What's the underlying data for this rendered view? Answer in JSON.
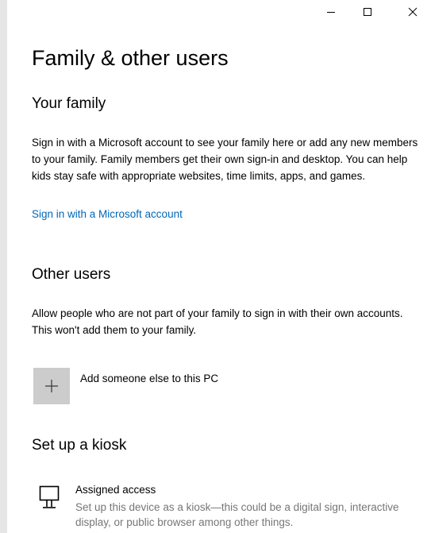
{
  "window": {
    "minimize_icon": "minimize-icon",
    "maximize_icon": "maximize-icon",
    "close_icon": "close-icon"
  },
  "page": {
    "title": "Family & other users"
  },
  "family": {
    "title": "Your family",
    "description": "Sign in with a Microsoft account to see your family here or add any new members to your family. Family members get their own sign-in and desktop. You can help kids stay safe with appropriate websites, time limits, apps, and games.",
    "link": "Sign in with a Microsoft account"
  },
  "other_users": {
    "title": "Other users",
    "description": "Allow people who are not part of your family to sign in with their own accounts. This won't add them to your family.",
    "add_label": "Add someone else to this PC",
    "add_icon": "plus-icon"
  },
  "kiosk": {
    "title": "Set up a kiosk",
    "item_title": "Assigned access",
    "item_description": "Set up this device as a kiosk—this could be a digital sign, interactive display, or public browser among other things.",
    "item_icon": "kiosk-icon"
  },
  "colors": {
    "link": "#0067b8",
    "tile": "#cccccc",
    "secondary_text": "#767676",
    "left_edge": "#e6e6e6"
  }
}
